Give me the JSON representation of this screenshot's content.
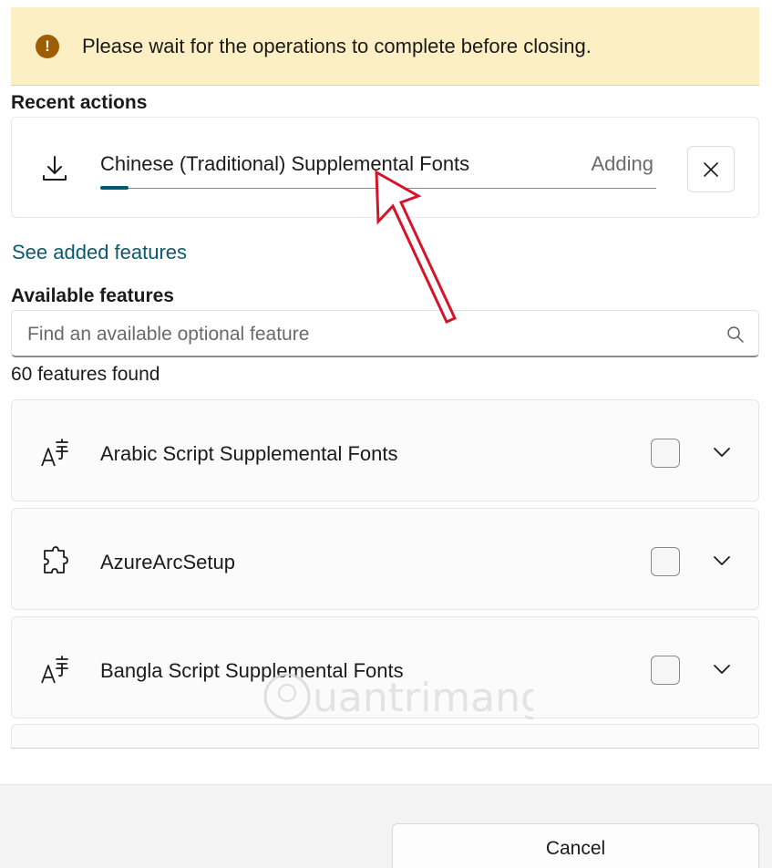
{
  "banner": {
    "icon": "warning-icon",
    "message": "Please wait for the operations to complete before closing."
  },
  "recent_actions": {
    "title": "Recent actions",
    "item": {
      "icon": "download-icon",
      "name": "Chinese (Traditional) Supplemental Fonts",
      "status": "Adding",
      "progress": 0.05
    }
  },
  "see_added_link": "See added features",
  "available": {
    "title": "Available features",
    "search_placeholder": "Find an available optional feature",
    "count_text": "60 features found",
    "features": [
      {
        "name": "Arabic Script Supplemental Fonts",
        "icon": "font-icon",
        "checked": false
      },
      {
        "name": "AzureArcSetup",
        "icon": "puzzle-icon",
        "checked": false
      },
      {
        "name": "Bangla Script Supplemental Fonts",
        "icon": "font-icon",
        "checked": false
      }
    ]
  },
  "footer": {
    "cancel_label": "Cancel"
  },
  "watermark": "Quantrimang",
  "colors": {
    "banner_bg": "#fcefc3",
    "warning_icon": "#9d5d00",
    "accent": "#005a6e",
    "annotation_arrow": "#d4142a"
  }
}
